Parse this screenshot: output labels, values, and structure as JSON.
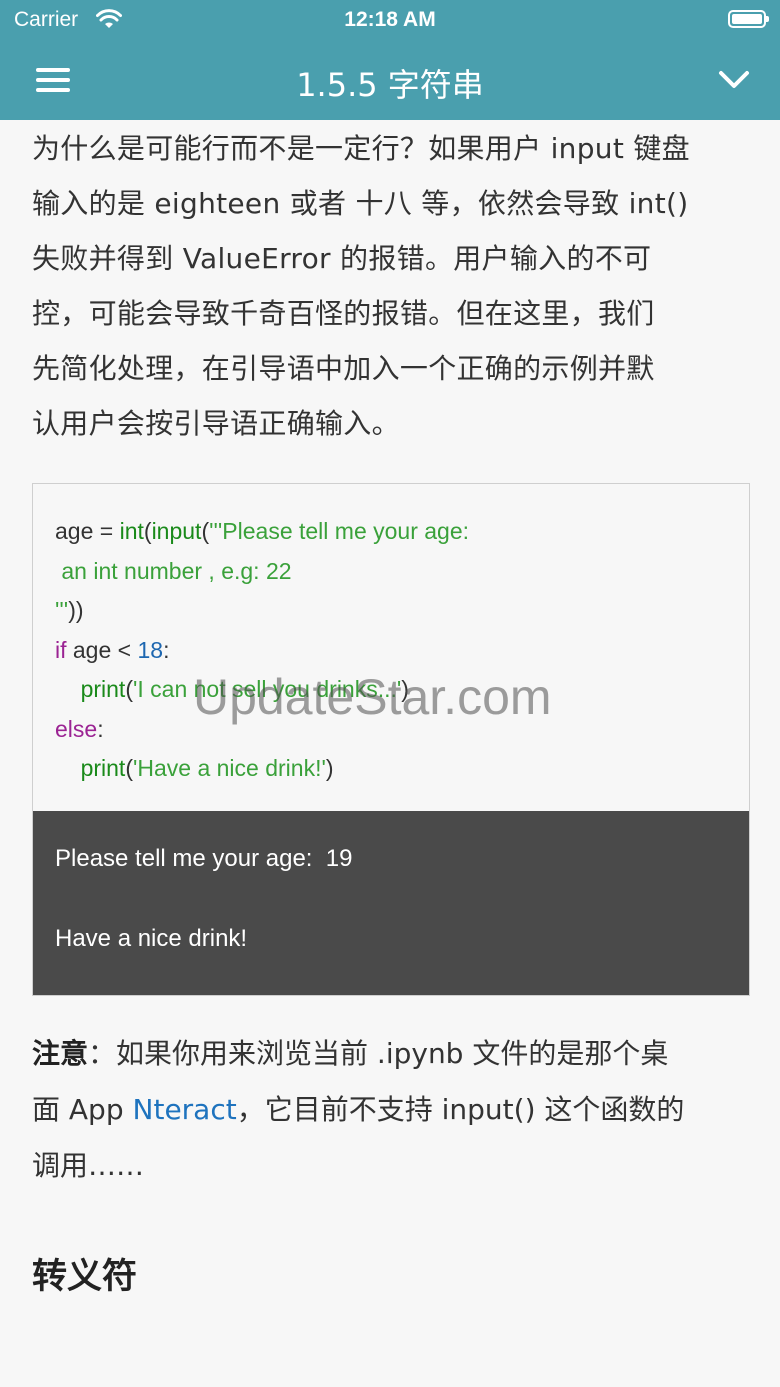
{
  "status_bar": {
    "carrier": "Carrier",
    "time": "12:18 AM"
  },
  "nav": {
    "title": "1.5.5 字符串",
    "menu_icon": "hamburger-icon",
    "dropdown_icon": "chevron-down-icon"
  },
  "content": {
    "paragraph_lines": [
      "为什么是可能行而不是一定行？如果用户 input 键盘",
      "输入的是 eighteen 或者 十八 等，依然会导致 int()",
      "失败并得到 ValueError 的报错。用户输入的不可",
      "控，可能会导致千奇百怪的报错。但在这里，我们",
      "先简化处理，在引导语中加入一个正确的示例并默",
      "认用户会按引导语正确输入。"
    ],
    "code": {
      "l1_var": "age = ",
      "l1_int": "int",
      "l1_p1": "(",
      "l1_input": "input",
      "l1_p2": "(",
      "l1_str": "'''Please tell me your age:",
      "l2_str": " an int number , e.g: 22",
      "l3_str": "'''",
      "l3_close": "))",
      "l4_if": "if",
      "l4_mid": " age < ",
      "l4_num": "18",
      "l4_colon": ":",
      "l5_indent": "    ",
      "l5_print": "print",
      "l5_p": "(",
      "l5_str": "'I can not sell you drinks...'",
      "l5_close": ")",
      "l6_else": "else",
      "l6_colon": ":",
      "l7_indent": "    ",
      "l7_print": "print",
      "l7_p": "(",
      "l7_str": "'Have a nice drink!'",
      "l7_close": ")"
    },
    "output_lines": [
      "Please tell me your age:  19",
      "",
      "Have a nice drink!"
    ],
    "note": {
      "label": "注意",
      "text1": "：如果你用来浏览当前 .ipynb 文件的是那个桌",
      "text2": "面 App ",
      "link": "Nteract",
      "text3": "，它目前不支持 input() 这个函数的",
      "text4": "调用……"
    },
    "section_heading": "转义符"
  },
  "watermark": "UpdateStar.com",
  "colors": {
    "accent": "#4a9fae",
    "link": "#1e73be",
    "output_bg": "#4a4a4a"
  }
}
